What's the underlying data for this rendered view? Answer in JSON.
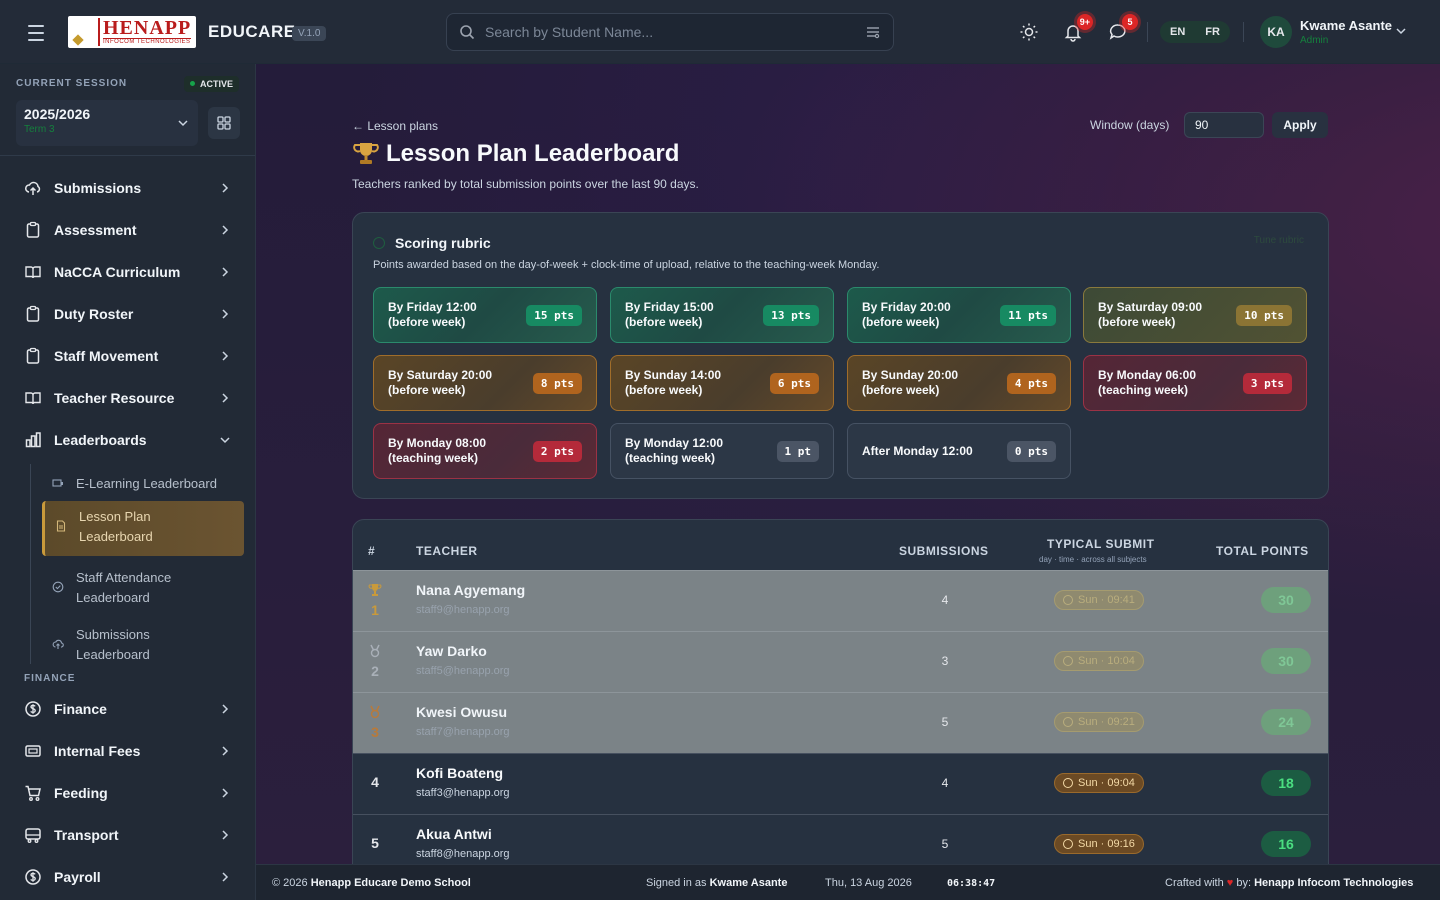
{
  "header": {
    "logo_title": "HENAPP",
    "logo_subtitle": "INFOCOM TECHNOLOGIES",
    "brand": "EDUCARE",
    "version": "V.1.0",
    "search_placeholder": "Search by Student Name...",
    "notifications_badge": "9+",
    "messages_badge": "5",
    "lang_en": "EN",
    "lang_fr": "FR",
    "user_initials": "KA",
    "user_name": "Kwame Asante",
    "user_role": "Admin"
  },
  "sidebar": {
    "session_label": "CURRENT SESSION",
    "session_status": "ACTIVE",
    "session_year": "2025/2026",
    "session_term": "Term 3",
    "items": [
      {
        "label": "Submissions"
      },
      {
        "label": "Assessment"
      },
      {
        "label": "NaCCA Curriculum"
      },
      {
        "label": "Duty Roster"
      },
      {
        "label": "Staff Movement"
      },
      {
        "label": "Teacher Resource"
      },
      {
        "label": "Leaderboards"
      }
    ],
    "sub_items": [
      {
        "label": "E-Learning Leaderboard"
      },
      {
        "label": "Lesson Plan Leaderboard"
      },
      {
        "label": "Staff Attendance Leaderboard"
      },
      {
        "label": "Submissions Leaderboard"
      }
    ],
    "finance_label": "FINANCE",
    "finance_items": [
      {
        "label": "Finance"
      },
      {
        "label": "Internal Fees"
      },
      {
        "label": "Feeding"
      },
      {
        "label": "Transport"
      },
      {
        "label": "Payroll"
      }
    ]
  },
  "main": {
    "back_link": "← Lesson plans",
    "title": "Lesson Plan Leaderboard",
    "subtitle": "Teachers ranked by total submission points over the last 90 days.",
    "window_label": "Window (days)",
    "window_value": "90",
    "apply_label": "Apply"
  },
  "rubric": {
    "title": "Scoring rubric",
    "tune_label": "Tune rubric",
    "description": "Points awarded based on the day-of-week + clock-time of upload, relative to the teaching-week Monday.",
    "cards": [
      {
        "l1": "By Friday 12:00",
        "l2": "(before week)",
        "pts": "15 pts",
        "tone": "green"
      },
      {
        "l1": "By Friday 15:00",
        "l2": "(before week)",
        "pts": "13 pts",
        "tone": "green"
      },
      {
        "l1": "By Friday 20:00",
        "l2": "(before week)",
        "pts": "11 pts",
        "tone": "green"
      },
      {
        "l1": "By Saturday 09:00",
        "l2": "(before week)",
        "pts": "10 pts",
        "tone": "olive"
      },
      {
        "l1": "By Saturday 20:00",
        "l2": "(before week)",
        "pts": "8 pts",
        "tone": "amber"
      },
      {
        "l1": "By Sunday 14:00",
        "l2": "(before week)",
        "pts": "6 pts",
        "tone": "amber"
      },
      {
        "l1": "By Sunday 20:00",
        "l2": "(before week)",
        "pts": "4 pts",
        "tone": "amber"
      },
      {
        "l1": "By Monday 06:00",
        "l2": "(teaching week)",
        "pts": "3 pts",
        "tone": "red"
      },
      {
        "l1": "By Monday 08:00",
        "l2": "(teaching week)",
        "pts": "2 pts",
        "tone": "red"
      },
      {
        "l1": "By Monday 12:00",
        "l2": "(teaching week)",
        "pts": "1 pt",
        "tone": "slate"
      },
      {
        "l1": "After Monday 12:00",
        "l2": "",
        "pts": "0 pts",
        "tone": "slate"
      }
    ]
  },
  "table": {
    "col_rank": "#",
    "col_teacher": "TEACHER",
    "col_submissions": "SUBMISSIONS",
    "col_typical": "TYPICAL SUBMIT",
    "col_typical_sub": "day · time · across all subjects",
    "col_total": "TOTAL POINTS",
    "rows": [
      {
        "rank": "1",
        "name": "Nana Agyemang",
        "email": "staff9@henapp.org",
        "submissions": "4",
        "typical": "Sun · 09:41",
        "total": "30"
      },
      {
        "rank": "2",
        "name": "Yaw Darko",
        "email": "staff5@henapp.org",
        "submissions": "3",
        "typical": "Sun · 10:04",
        "total": "30"
      },
      {
        "rank": "3",
        "name": "Kwesi Owusu",
        "email": "staff7@henapp.org",
        "submissions": "5",
        "typical": "Sun · 09:21",
        "total": "24"
      },
      {
        "rank": "4",
        "name": "Kofi Boateng",
        "email": "staff3@henapp.org",
        "submissions": "4",
        "typical": "Sun · 09:04",
        "total": "18"
      },
      {
        "rank": "5",
        "name": "Akua Antwi",
        "email": "staff8@henapp.org",
        "submissions": "5",
        "typical": "Sun · 09:16",
        "total": "16"
      }
    ]
  },
  "footer": {
    "copyright_prefix": "© 2026",
    "school": "Henapp Educare Demo School",
    "signed_prefix": "Signed in as",
    "signed_user": "Kwame Asante",
    "date": "Thu, 13 Aug 2026",
    "time": "06:38:47",
    "crafted_prefix": "Crafted with",
    "crafted_by": "by:",
    "company": "Henapp Infocom Technologies"
  },
  "colors": {
    "accent_green": "#16a34a",
    "badge_red": "#dc2626",
    "active_gold": "#c99a3b"
  }
}
